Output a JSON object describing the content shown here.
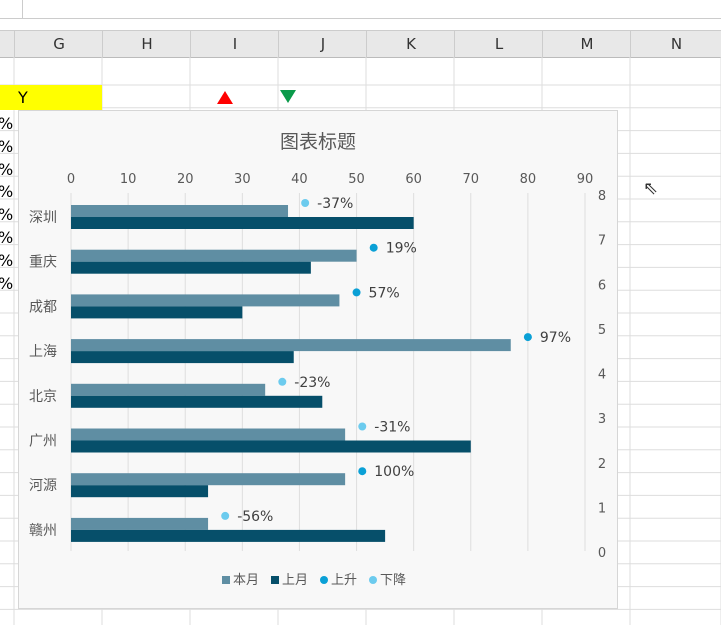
{
  "sheet": {
    "columns": [
      "G",
      "H",
      "I",
      "J",
      "K",
      "L",
      "M",
      "N"
    ],
    "cell_y": "Y",
    "row_pct": "%"
  },
  "chart_data": {
    "type": "bar",
    "title": "图表标题",
    "categories": [
      "深圳",
      "重庆",
      "成都",
      "上海",
      "北京",
      "广州",
      "河源",
      "赣州"
    ],
    "series": [
      {
        "name": "本月",
        "color": "#5f8ea3",
        "values": [
          38,
          50,
          47,
          77,
          34,
          48,
          48,
          24
        ]
      },
      {
        "name": "上月",
        "color": "#064f6a",
        "values": [
          60,
          42,
          30,
          39,
          44,
          70,
          24,
          55
        ]
      }
    ],
    "markers": [
      {
        "name": "上升",
        "color": "#0aa0d6"
      },
      {
        "name": "下降",
        "color": "#6ccbee"
      }
    ],
    "changes": [
      "-37%",
      "19%",
      "57%",
      "97%",
      "-23%",
      "-31%",
      "100%",
      "-56%"
    ],
    "x_axis": {
      "min": 0,
      "max": 90,
      "ticks": [
        0,
        10,
        20,
        30,
        40,
        50,
        60,
        70,
        80,
        90
      ]
    },
    "y2_axis": {
      "min": 0,
      "max": 8,
      "ticks": [
        0,
        1,
        2,
        3,
        4,
        5,
        6,
        7,
        8
      ]
    },
    "legend": "bottom"
  }
}
